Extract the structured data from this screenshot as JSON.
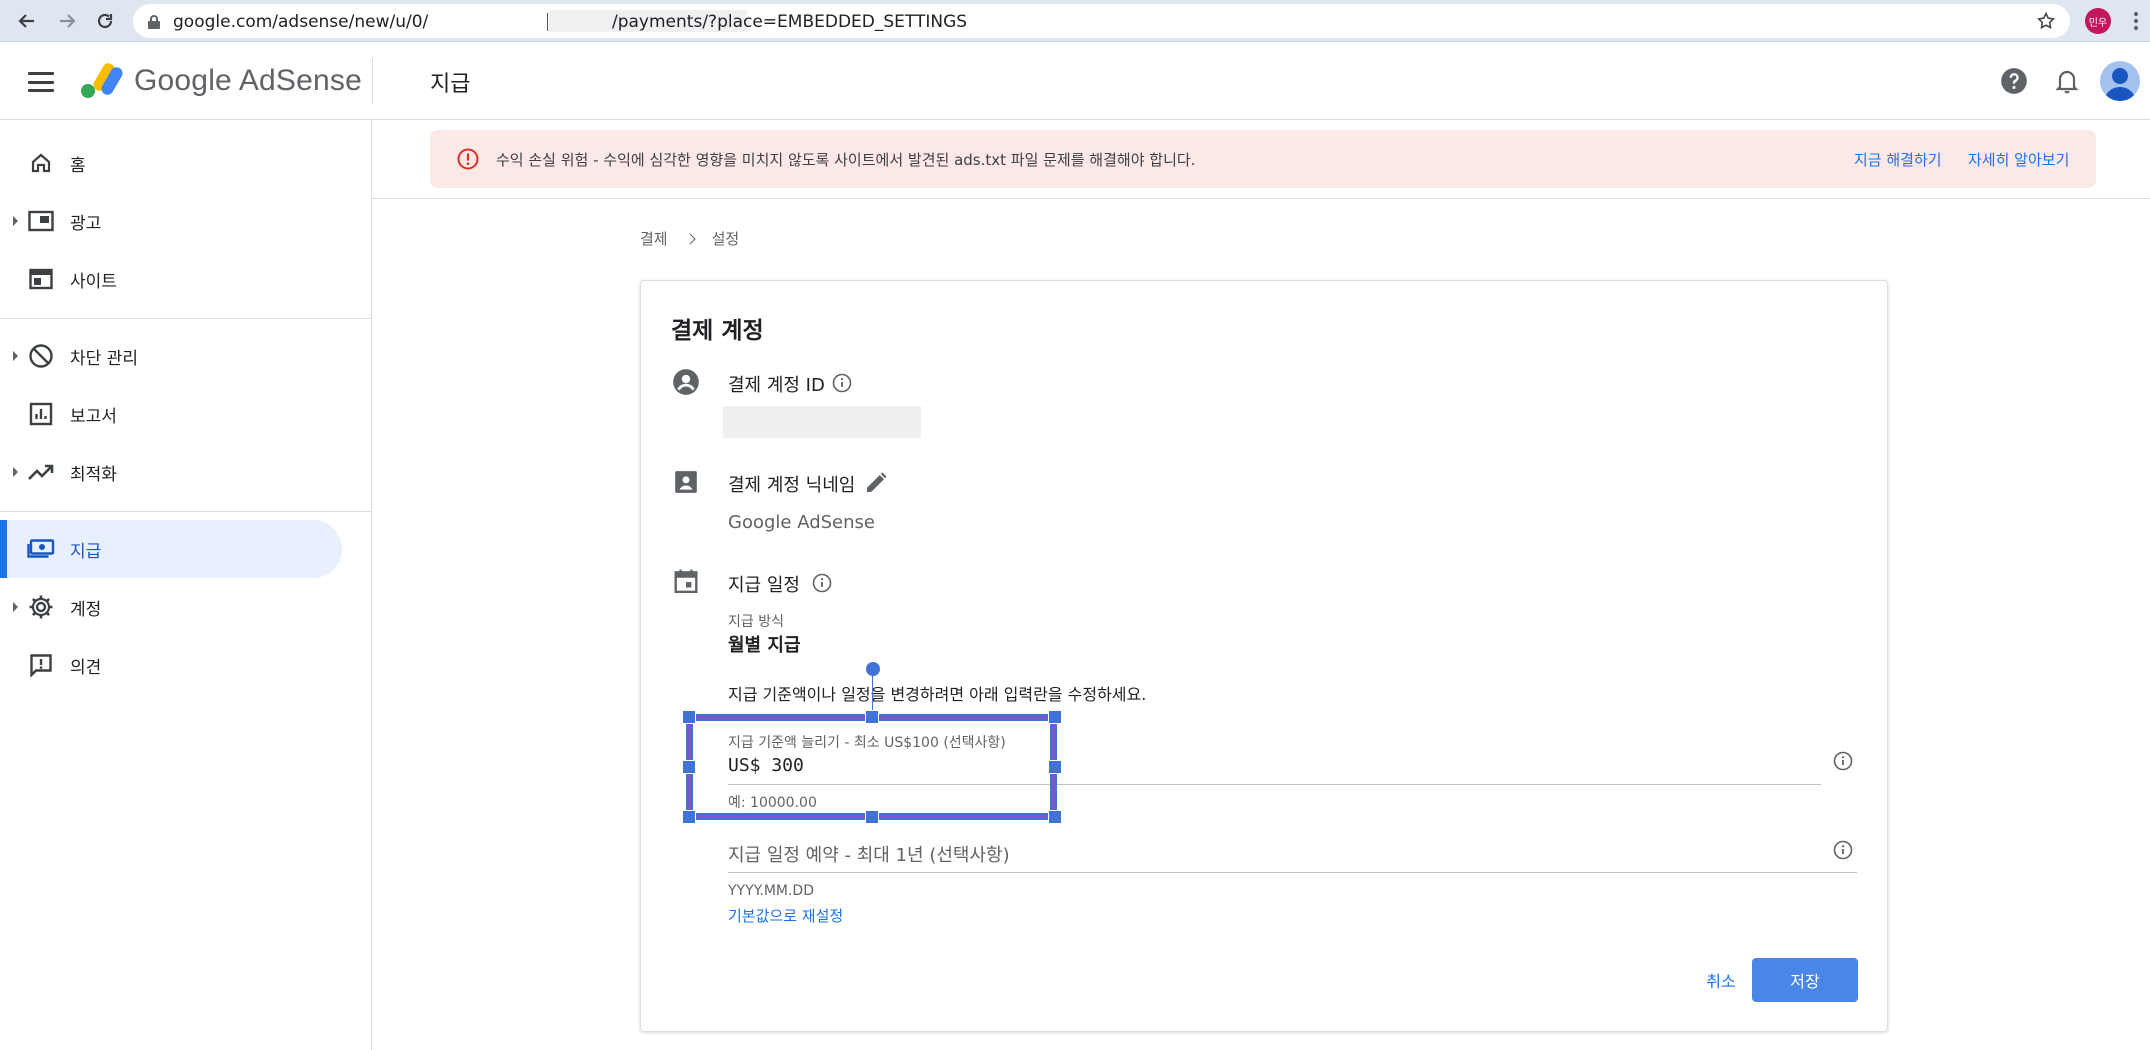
{
  "browser": {
    "url_prefix": "google.com/adsense/new/u/0/",
    "url_suffix": "/payments/?place=EMBEDDED_SETTINGS",
    "profile_initials": "민우"
  },
  "header": {
    "brand": "Google AdSense",
    "page_title": "지급"
  },
  "sidebar": {
    "items": [
      {
        "label": "홈",
        "icon": "home-icon"
      },
      {
        "label": "광고",
        "icon": "ads-icon"
      },
      {
        "label": "사이트",
        "icon": "sites-icon"
      },
      {
        "label": "차단 관리",
        "icon": "block-icon"
      },
      {
        "label": "보고서",
        "icon": "reports-icon"
      },
      {
        "label": "최적화",
        "icon": "optimization-icon"
      },
      {
        "label": "지급",
        "icon": "payments-icon"
      },
      {
        "label": "계정",
        "icon": "account-gear-icon"
      },
      {
        "label": "의견",
        "icon": "feedback-icon"
      }
    ]
  },
  "alert": {
    "message": "수익 손실 위험 - 수익에 심각한 영향을 미치지 않도록 사이트에서 발견된 ads.txt 파일 문제를 해결해야 합니다.",
    "fix_label": "지금 해결하기",
    "learn_label": "자세히 알아보기",
    "color": "#fce8e6"
  },
  "breadcrumb": {
    "parent": "결제",
    "current": "설정"
  },
  "card": {
    "title": "결제 계정",
    "account_id_label": "결제 계정 ID",
    "nickname_label": "결제 계정 닉네임",
    "nickname_value": "Google AdSense",
    "schedule_label": "지급 일정",
    "method_label": "지급 방식",
    "method_value": "월별 지급",
    "instructions": "지급 기준액이나 일정을 변경하려면 아래 입력란을 수정하세요.",
    "threshold_label": "지급 기준액 늘리기 - 최소 US$100 (선택사항)",
    "threshold_value": "US$ 300",
    "threshold_hint": "예: 10000.00",
    "schedule_field_placeholder": "지급 일정 예약 - 최대 1년 (선택사항)",
    "schedule_hint": "YYYY.MM.DD",
    "reset_label": "기본값으로 재설정",
    "cancel_label": "취소",
    "save_label": "저장"
  },
  "colors": {
    "accent": "#1a73e8",
    "save_button": "#4a86e8",
    "active_nav": "#e8f0fe"
  }
}
